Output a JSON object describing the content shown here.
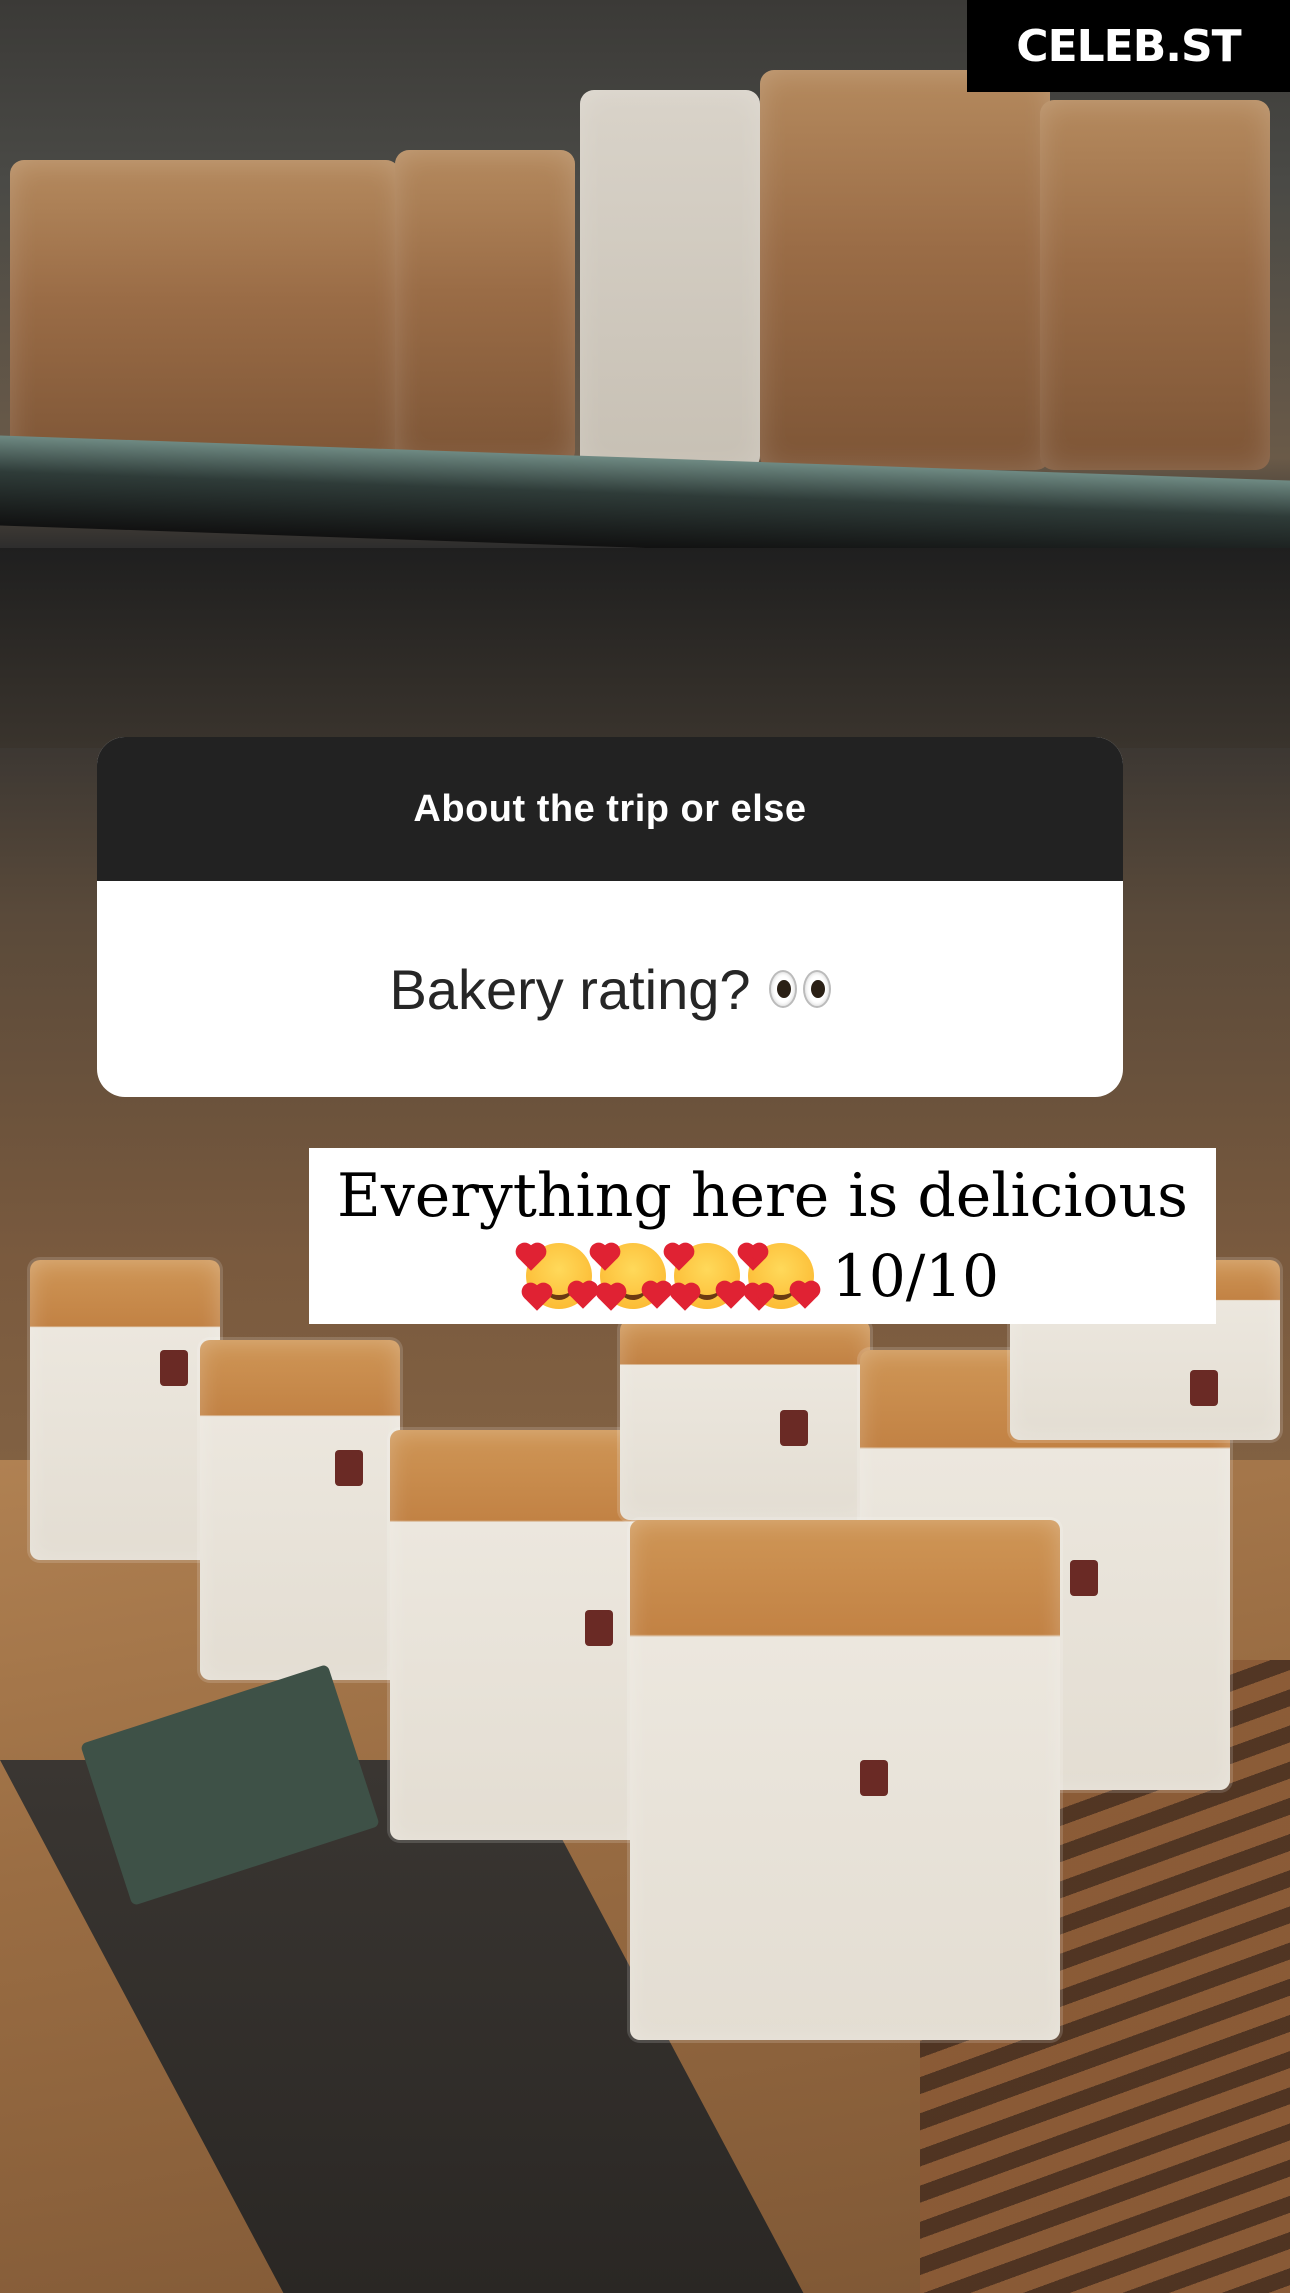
{
  "brand": {
    "name": "CELEB.ST"
  },
  "question_sticker": {
    "prompt": "About the trip or else",
    "question": "Bakery rating?",
    "question_emoji": "eyes-emoji"
  },
  "answer": {
    "line1": "Everything here is delicious",
    "emoji": "smiling-face-with-hearts-emoji",
    "emoji_count": 4,
    "rating": "10/10"
  },
  "colors": {
    "header_bg": "#222222",
    "card_bg": "#ffffff",
    "brand_bg": "#000000"
  }
}
